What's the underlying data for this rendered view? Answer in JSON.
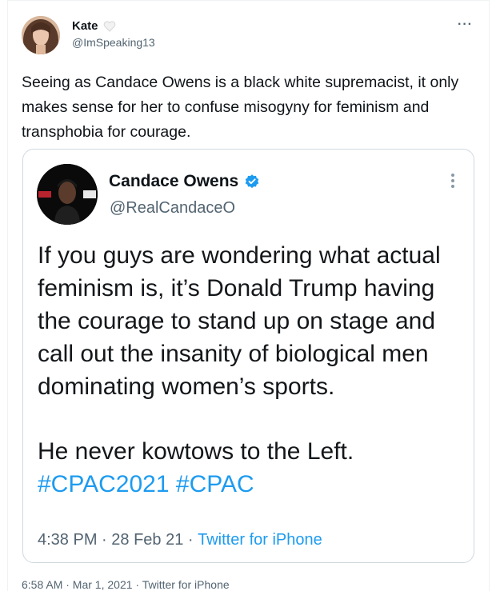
{
  "tweet": {
    "author_name": "Kate",
    "author_handle": "@ImSpeaking13",
    "more_icon": "more-horizontal-icon",
    "text": "Seeing as Candace Owens is a black white supremacist, it only makes sense for her to confuse misogyny for feminism and transphobia for courage.",
    "meta": "6:58 AM · Mar 1, 2021 · Twitter for iPhone"
  },
  "quote": {
    "author_name": "Candace Owens",
    "author_handle": "@RealCandaceO",
    "verified_icon": "verified-badge-icon",
    "more_icon": "more-vertical-icon",
    "paragraph1": "If you guys are wondering what actual feminism is, it’s Donald Trump having the courage to stand up on stage and call out the insanity of biological men dominating women’s sports.",
    "paragraph2": "He never kowtows to the Left.",
    "hashtag1": "#CPAC2021",
    "hashtag2": "#CPAC",
    "time": "4:38 PM",
    "date": "28 Feb 21",
    "source": "Twitter for iPhone"
  },
  "colors": {
    "link": "#1d9bf0",
    "secondary_text": "#536471",
    "border": "#cfd9de"
  }
}
